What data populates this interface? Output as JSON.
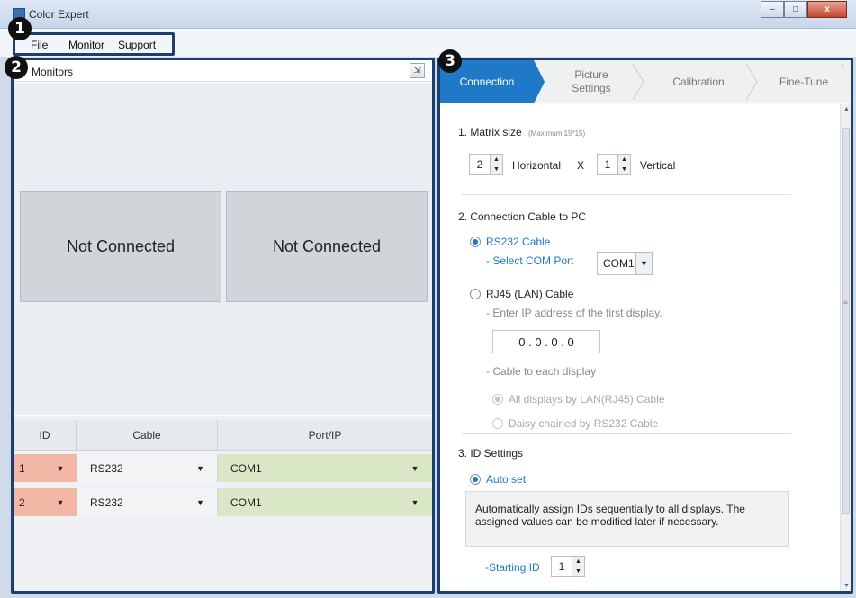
{
  "window": {
    "title": "Color Expert",
    "minimize": "–",
    "maximize": "□",
    "close": "x"
  },
  "menu": {
    "items": [
      "File",
      "Monitor",
      "Support"
    ]
  },
  "badges": [
    "1",
    "2",
    "3"
  ],
  "monitors": {
    "title": "Monitors",
    "export_icon": "export-icon",
    "tiles": [
      "Not Connected",
      "Not Connected"
    ]
  },
  "grid": {
    "headers": {
      "id": "ID",
      "cable": "Cable",
      "port": "Port/IP"
    },
    "rows": [
      {
        "id": "1",
        "cable": "RS232",
        "port": "COM1"
      },
      {
        "id": "2",
        "cable": "RS232",
        "port": "COM1"
      }
    ]
  },
  "tabs": [
    {
      "label": "Connection",
      "active": true
    },
    {
      "label": "Picture\nSettings",
      "active": false
    },
    {
      "label": "Calibration",
      "active": false
    },
    {
      "label": "Fine-Tune",
      "active": false
    }
  ],
  "tab_plus": "+",
  "connection": {
    "s1_title": "1. Matrix size",
    "s1_note": "(Maximum 15*15)",
    "horizontal_value": "2",
    "horizontal_label": "Horizontal",
    "x_label": "X",
    "vertical_value": "1",
    "vertical_label": "Vertical",
    "s2_title": "2. Connection Cable to PC",
    "rs232_label": "RS232 Cable",
    "select_com_label": "- Select COM Port",
    "com_value": "COM1",
    "rj45_label": "RJ45 (LAN) Cable",
    "enter_ip_label": "- Enter IP address of the first display.",
    "ip_value": "0 . 0 . 0 . 0",
    "cable_each_label": "- Cable to each display",
    "all_lan_label": "All displays by LAN(RJ45) Cable",
    "daisy_label": "Daisy chained by RS232 Cable",
    "s3_title": "3. ID Settings",
    "auto_set_label": "Auto set",
    "auto_info": "Automatically assign IDs sequentially to all displays. The assigned values can be modified later if necessary.",
    "starting_id_label": "-Starting ID",
    "starting_id_value": "1"
  },
  "colors": {
    "accent": "#1f78c8",
    "badge_border": "#1c3f6e",
    "id_cell": "#f3b7a6",
    "port_cell": "#d9e7c6"
  }
}
